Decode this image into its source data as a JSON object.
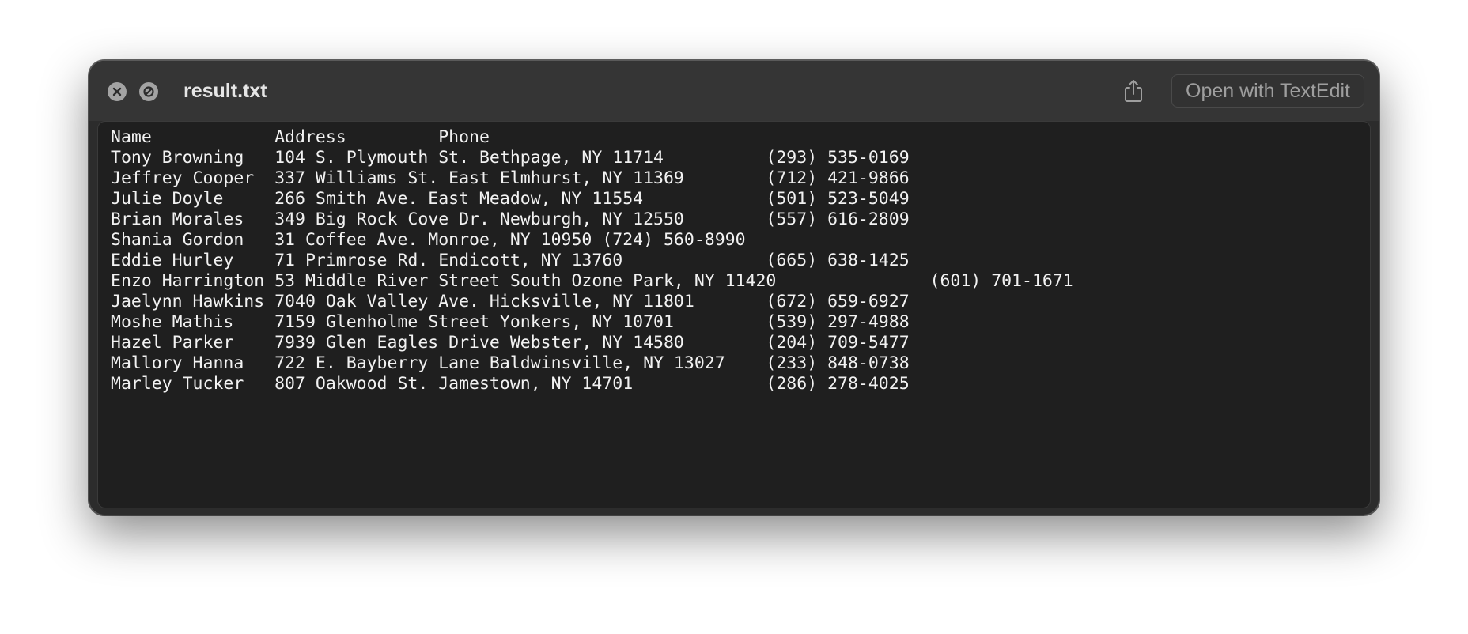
{
  "window": {
    "title": "result.txt",
    "open_button_label": "Open with TextEdit"
  },
  "icons": {
    "close": "close-icon",
    "stop": "stop-icon",
    "share": "share-icon"
  },
  "file": {
    "lines": [
      "Name\tAddress\tPhone",
      "Tony Browning\t104 S. Plymouth St. Bethpage, NY 11714\t(293) 535-0169",
      "Jeffrey Cooper\t337 Williams St. East Elmhurst, NY 11369\t(712) 421-9866",
      "Julie Doyle\t266 Smith Ave. East Meadow, NY 11554\t(501) 523-5049",
      "Brian Morales\t349 Big Rock Cove Dr. Newburgh, NY 12550\t(557) 616-2809",
      "Shania Gordon\t31 Coffee Ave. Monroe, NY 10950\t(724) 560-8990",
      "Eddie Hurley\t71 Primrose Rd. Endicott, NY 13760\t(665) 638-1425",
      "Enzo Harrington\t53 Middle River Street South Ozone Park, NY 11420\t(601) 701-1671",
      "Jaelynn Hawkins\t7040 Oak Valley Ave. Hicksville, NY 11801\t(672) 659-6927",
      "Moshe Mathis\t7159 Glenholme Street Yonkers, NY 10701\t(539) 297-4988",
      "Hazel Parker\t7939 Glen Eagles Drive Webster, NY 14580\t(204) 709-5477",
      "Mallory Hanna\t722 E. Bayberry Lane Baldwinsville, NY 13027\t(233) 848-0738",
      "Marley Tucker\t807 Oakwood St. Jamestown, NY 14701\t(286) 278-4025"
    ]
  }
}
